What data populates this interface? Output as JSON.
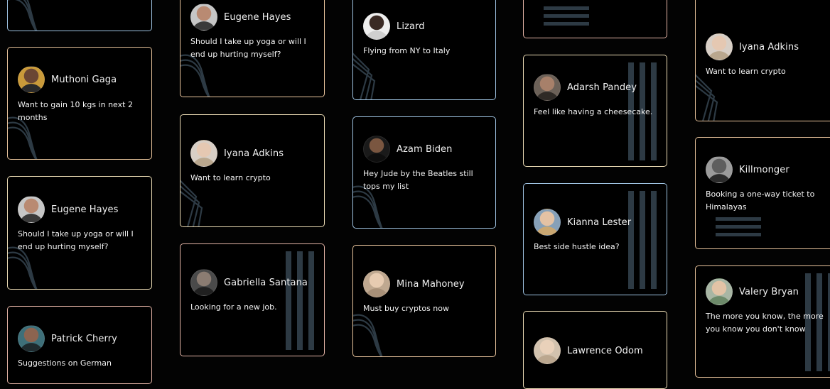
{
  "colors": {
    "peach": "#e9c49c",
    "blue": "#9fc3e2",
    "pink": "#e3b3a5",
    "cream": "#ecdcb5",
    "stripe": "#2d3a44"
  },
  "cards": [
    {
      "name": "",
      "message": "",
      "avatar": null
    },
    {
      "name": "Muthoni Gaga",
      "message": "Want to gain 10 kgs in next 2 months",
      "avatar": {
        "bg": "#c99a3a",
        "skin": "#6a4634",
        "shirt": "#2a2a2a"
      }
    },
    {
      "name": "Eugene Hayes",
      "message": "Should I take up yoga or will I end up hurting myself?",
      "avatar": {
        "bg": "#c6c6c6",
        "skin": "#b98a72",
        "shirt": "#3a3a3a"
      }
    },
    {
      "name": "Patrick Cherry",
      "message": "Suggestions on German",
      "avatar": {
        "bg": "#3e6f79",
        "skin": "#8c6450",
        "shirt": "#1e2a2e"
      }
    },
    {
      "name": "Eugene Hayes",
      "message": "Should I take up yoga or will I end up hurting myself?",
      "avatar": {
        "bg": "#c6c6c6",
        "skin": "#b98a72",
        "shirt": "#3a3a3a"
      }
    },
    {
      "name": "Iyana Adkins",
      "message": "Want to learn crypto",
      "avatar": {
        "bg": "#d8cfc6",
        "skin": "#e5c8b2",
        "shirt": "#b9a78e"
      }
    },
    {
      "name": "Gabriella Santana",
      "message": "Looking for a new job.",
      "avatar": {
        "bg": "#4a4a4a",
        "skin": "#8b7c72",
        "shirt": "#202020"
      }
    },
    {
      "name": "Lizard",
      "message": "Flying from NY to Italy",
      "avatar": {
        "bg": "#eeeeee",
        "skin": "#3a2a24",
        "shirt": "#cfcfcf"
      }
    },
    {
      "name": "Azam Biden",
      "message": "Hey Jude by the Beatles still tops my list",
      "avatar": {
        "bg": "#1a1a1a",
        "skin": "#7a5640",
        "shirt": "#0e0e0e"
      }
    },
    {
      "name": "Mina Mahoney",
      "message": "Must buy cryptos now",
      "avatar": {
        "bg": "#bfa890",
        "skin": "#e7cbb1",
        "shirt": "#a89078"
      }
    },
    {
      "name": "",
      "message": "",
      "avatar": null
    },
    {
      "name": "Adarsh Pandey",
      "message": "Feel like having a cheesecake.",
      "avatar": {
        "bg": "#6c6158",
        "skin": "#a7806a",
        "shirt": "#2f2a26"
      }
    },
    {
      "name": "Kianna Lester",
      "message": "Best side hustle idea?",
      "avatar": {
        "bg": "#86a0b8",
        "skin": "#e4c2a4",
        "shirt": "#c9a772"
      }
    },
    {
      "name": "Lawrence Odom",
      "message": "",
      "avatar": {
        "bg": "#d2c2ae",
        "skin": "#e9d1ba",
        "shirt": "#bba78f"
      }
    },
    {
      "name": "Iyana Adkins",
      "message": "Want to learn crypto",
      "avatar": {
        "bg": "#d8cfc6",
        "skin": "#e5c8b2",
        "shirt": "#b9a78e"
      }
    },
    {
      "name": "Killmonger",
      "message": "Booking a one-way ticket to Himalayas",
      "avatar": {
        "bg": "#9b9b9b",
        "skin": "#5e5e5e",
        "shirt": "#2c2c2c"
      }
    },
    {
      "name": "Valery Bryan",
      "message": "The more you know, the more you know you don't know",
      "avatar": {
        "bg": "#a8b6a4",
        "skin": "#e2c3a6",
        "shirt": "#6d8a6a"
      }
    }
  ]
}
